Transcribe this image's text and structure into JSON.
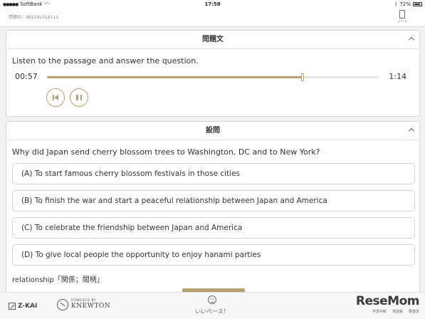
{
  "status_bar": {
    "carrier": "SoftBank",
    "time": "17:58",
    "battery": "72%"
  },
  "header": {
    "problem_id": "問題ID：NEL04L01A111",
    "note_label": "ノート"
  },
  "passage_card": {
    "title": "問題文",
    "instruction": "Listen to the passage and answer the question.",
    "audio": {
      "current_time": "00:57",
      "total_time": "1:14",
      "progress": 0.77
    }
  },
  "question_card": {
    "title": "設問",
    "question": "Why did Japan send cherry blossom trees to Washington, DC and to New York?",
    "options": [
      "(A) To start famous cherry blossom festivals in those cities",
      "(B) To finish the war and start a peaceful relationship between Japan and America",
      "(C) To celebrate the friendship between Japan and America",
      "(D) To give local people the opportunity to enjoy hanami parties"
    ],
    "vocab_note": "relationship「関係；間柄」"
  },
  "footer": {
    "zkai": "Z-KAI",
    "knewton_small": "POWERED BY",
    "knewton_big": "KNEWTON",
    "pace_label": "いいペース！",
    "brand": "ReseMom",
    "tabs": [
      "学習中断",
      "単語帳",
      "要復習"
    ]
  },
  "colors": {
    "accent": "#b8a06a",
    "border": "#d3d3d3",
    "background": "#f2f2f2"
  }
}
